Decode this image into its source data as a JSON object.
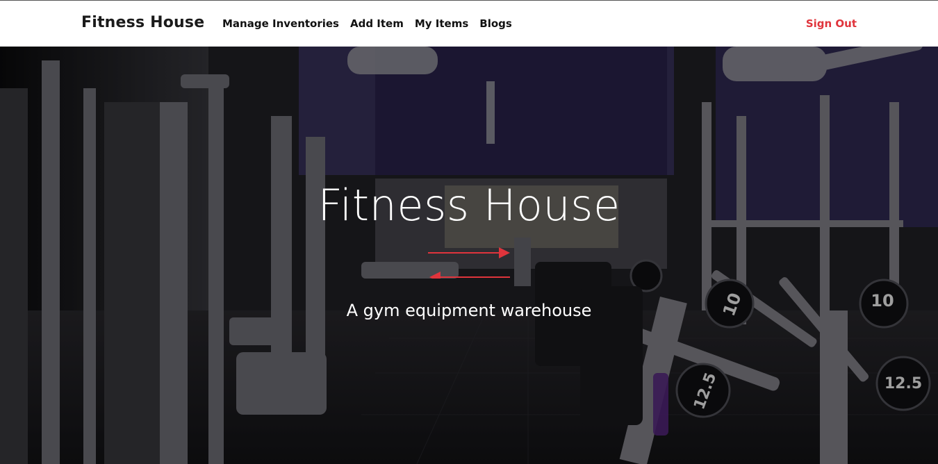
{
  "navbar": {
    "brand": "Fitness House",
    "links": [
      {
        "label": "Manage Inventories"
      },
      {
        "label": "Add Item"
      },
      {
        "label": "My Items"
      },
      {
        "label": "Blogs"
      }
    ],
    "signout_label": "Sign Out"
  },
  "hero": {
    "title": "Fitness House",
    "subtitle": "A gym equipment warehouse",
    "background": "gym-interior-photo",
    "arrow_icon": "double-arrow-icon",
    "accent_color": "#e0343c",
    "weights": [
      {
        "label": "10"
      },
      {
        "label": "10"
      },
      {
        "label": "12.5"
      },
      {
        "label": "12.5"
      }
    ]
  }
}
